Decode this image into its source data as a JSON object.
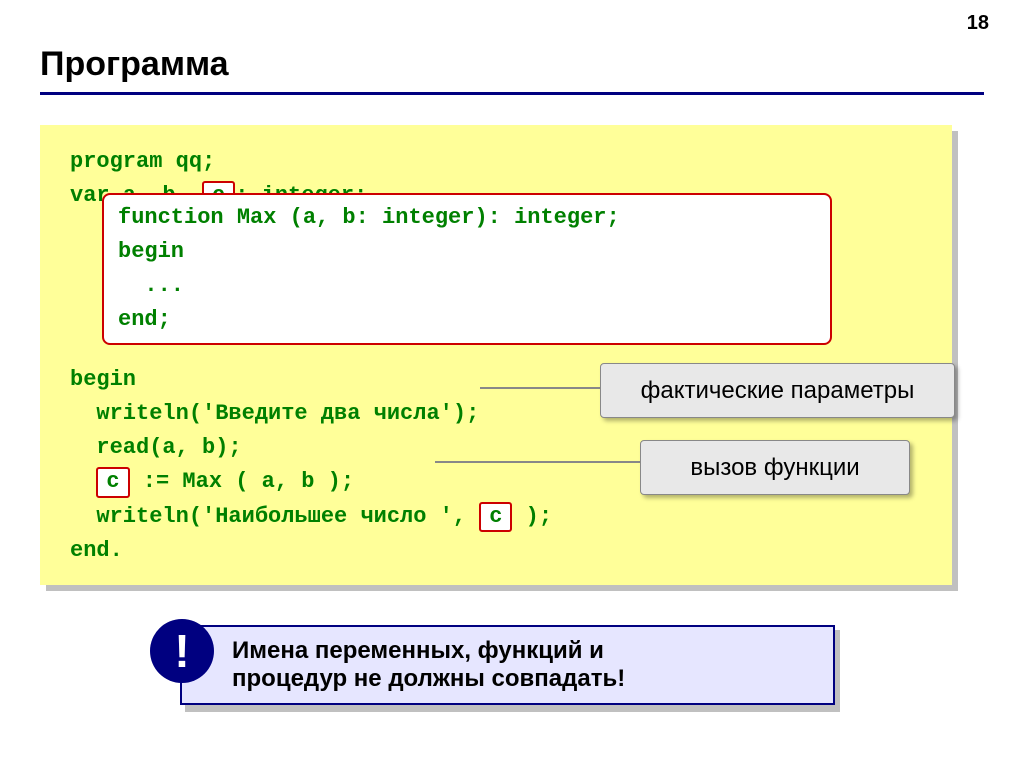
{
  "page_number": "18",
  "title": "Программа",
  "code": {
    "line1": "program qq;",
    "line2a": "var a, b, ",
    "line2_c": "c",
    "line2b": ": integer;",
    "func_line1": "function Max (a, b: integer): integer;",
    "func_line2": "begin",
    "func_line3": "  ...",
    "func_line4": "end;",
    "line_begin": "begin",
    "line_writeln1": "  writeln('Введите два числа');",
    "line_read": "  read(a, b);",
    "line_assign_c": "c",
    "line_assign_rest": " := Max ( a, b );",
    "line_writeln2a": "  writeln('Наибольшее число ', ",
    "line_writeln2_c": "c",
    "line_writeln2b": " );",
    "line_end": "end."
  },
  "callouts": {
    "params": "фактические параметры",
    "call": "вызов функции"
  },
  "note": {
    "mark": "!",
    "text1": "Имена переменных, функций и",
    "text2": "процедур не должны совпадать!"
  }
}
